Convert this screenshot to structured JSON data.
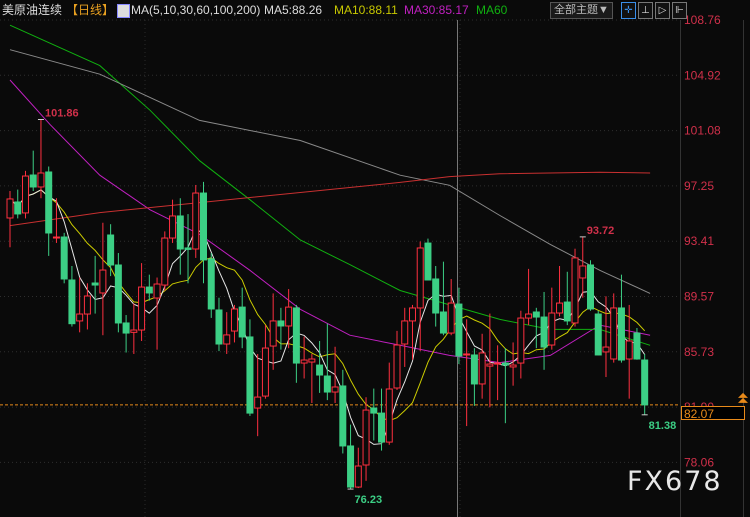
{
  "header": {
    "symbol": "美原油连续",
    "period": "【日线】",
    "ma_params": "MA(5,10,30,60,100,200)",
    "ma5": "MA5:88.26",
    "ma10": "MA10:88.11",
    "ma30": "MA30:85.17",
    "ma60": "MA60",
    "theme_button": "全部主题▼",
    "tool_icons": [
      "crosshair-icon",
      "bar-style-icon",
      "play-icon",
      "exit-icon"
    ]
  },
  "watermark": "FX678",
  "colors": {
    "up": "#ff3040",
    "down": "#3ccf85",
    "ma5": "#e6e6e6",
    "ma10": "#cccc00",
    "ma30": "#c020c0",
    "ma60": "#10b010",
    "ma100": "#8a8a8a",
    "ma200": "#c83030",
    "accent": "#e88a1a",
    "axis_text": "#d0304a"
  },
  "chart_data": {
    "type": "candlestick",
    "title": "美原油连续 日线",
    "y_ticks": [
      "108.76",
      "104.92",
      "101.08",
      "97.25",
      "93.41",
      "89.57",
      "85.73",
      "81.90",
      "78.06"
    ],
    "ylim": [
      76.0,
      108.76
    ],
    "last_price": "82.07",
    "annotations": [
      {
        "text": "101.86",
        "index": 4,
        "price": 101.86,
        "kind": "high"
      },
      {
        "text": "93.72",
        "index": 74,
        "price": 93.72,
        "kind": "high"
      },
      {
        "text": "76.23",
        "index": 44,
        "price": 76.23,
        "kind": "low"
      },
      {
        "text": "81.38",
        "index": 82,
        "price": 81.38,
        "kind": "low"
      }
    ],
    "ohlc": [
      [
        95.03,
        96.9,
        93.0,
        96.35
      ],
      [
        96.14,
        97.0,
        95.0,
        95.31
      ],
      [
        95.38,
        98.3,
        95.0,
        97.94
      ],
      [
        98.01,
        99.7,
        96.9,
        97.18
      ],
      [
        97.18,
        101.86,
        96.4,
        98.15
      ],
      [
        98.22,
        98.6,
        92.4,
        93.99
      ],
      [
        93.64,
        96.4,
        93.3,
        93.71
      ],
      [
        93.71,
        94.0,
        90.5,
        90.8
      ],
      [
        90.73,
        91.7,
        87.5,
        87.7
      ],
      [
        87.89,
        90.9,
        87.1,
        88.37
      ],
      [
        88.37,
        90.5,
        87.3,
        89.62
      ],
      [
        90.52,
        92.4,
        88.4,
        90.38
      ],
      [
        89.83,
        94.7,
        86.9,
        91.42
      ],
      [
        93.85,
        94.6,
        91.0,
        91.77
      ],
      [
        91.77,
        92.6,
        87.1,
        87.75
      ],
      [
        87.75,
        88.3,
        85.7,
        87.05
      ],
      [
        87.1,
        89.1,
        85.6,
        87.26
      ],
      [
        87.26,
        91.9,
        86.5,
        90.24
      ],
      [
        90.24,
        91.1,
        89.3,
        89.83
      ],
      [
        89.48,
        90.9,
        85.9,
        90.45
      ],
      [
        90.38,
        94.1,
        90.0,
        93.64
      ],
      [
        93.64,
        96.3,
        93.3,
        95.17
      ],
      [
        95.17,
        96.4,
        91.1,
        92.88
      ],
      [
        92.95,
        95.3,
        90.5,
        92.85
      ],
      [
        92.88,
        97.32,
        92.26,
        96.76
      ],
      [
        96.76,
        97.53,
        90.5,
        92.12
      ],
      [
        92.19,
        92.6,
        88.1,
        88.72
      ],
      [
        88.65,
        89.5,
        85.8,
        86.29
      ],
      [
        86.29,
        88.5,
        85.6,
        86.92
      ],
      [
        87.19,
        89.0,
        86.4,
        88.72
      ],
      [
        88.85,
        90.2,
        86.0,
        86.78
      ],
      [
        86.78,
        88.0,
        81.3,
        81.5
      ],
      [
        81.85,
        85.6,
        79.9,
        82.61
      ],
      [
        82.68,
        87.6,
        82.5,
        86.01
      ],
      [
        86.15,
        89.8,
        84.5,
        87.89
      ],
      [
        87.89,
        88.8,
        85.9,
        87.54
      ],
      [
        87.54,
        90.1,
        86.0,
        88.85
      ],
      [
        88.79,
        89.0,
        83.6,
        84.97
      ],
      [
        84.97,
        86.8,
        83.9,
        85.18
      ],
      [
        85.04,
        85.6,
        82.2,
        85.25
      ],
      [
        84.83,
        86.5,
        82.9,
        84.14
      ],
      [
        84.07,
        87.7,
        82.4,
        82.96
      ],
      [
        82.96,
        86.1,
        82.2,
        83.31
      ],
      [
        83.38,
        84.5,
        78.7,
        79.22
      ],
      [
        79.22,
        80.7,
        76.23,
        76.37
      ],
      [
        76.37,
        79.1,
        76.3,
        77.83
      ],
      [
        77.9,
        82.6,
        76.8,
        81.71
      ],
      [
        81.85,
        83.2,
        79.6,
        81.5
      ],
      [
        81.5,
        83.2,
        78.9,
        79.49
      ],
      [
        79.49,
        85.0,
        79.3,
        83.17
      ],
      [
        83.24,
        87.2,
        83.1,
        86.22
      ],
      [
        86.29,
        88.8,
        84.7,
        87.89
      ],
      [
        87.89,
        89.0,
        85.2,
        88.79
      ],
      [
        88.79,
        93.4,
        85.8,
        92.95
      ],
      [
        93.29,
        93.6,
        90.7,
        90.73
      ],
      [
        90.8,
        91.7,
        87.5,
        88.44
      ],
      [
        88.51,
        92.0,
        86.9,
        87.05
      ],
      [
        87.05,
        90.8,
        86.9,
        89.13
      ],
      [
        89.06,
        90.2,
        84.9,
        85.46
      ],
      [
        85.53,
        88.0,
        80.6,
        85.6
      ],
      [
        85.53,
        86.0,
        82.0,
        83.52
      ],
      [
        83.52,
        87.0,
        82.5,
        85.67
      ],
      [
        84.76,
        88.4,
        81.9,
        84.9
      ],
      [
        84.9,
        86.2,
        82.4,
        84.97
      ],
      [
        84.97,
        86.0,
        80.8,
        84.83
      ],
      [
        84.7,
        86.4,
        83.4,
        84.83
      ],
      [
        84.97,
        88.6,
        83.9,
        88.09
      ],
      [
        88.09,
        91.5,
        87.6,
        88.37
      ],
      [
        88.51,
        88.8,
        86.0,
        88.16
      ],
      [
        88.16,
        89.9,
        84.5,
        86.08
      ],
      [
        86.22,
        90.2,
        85.9,
        88.44
      ],
      [
        88.44,
        91.7,
        88.2,
        89.13
      ],
      [
        89.2,
        91.3,
        87.6,
        87.89
      ],
      [
        87.75,
        92.9,
        87.5,
        92.26
      ],
      [
        90.87,
        93.72,
        89.5,
        91.7
      ],
      [
        91.77,
        92.1,
        88.6,
        88.72
      ],
      [
        88.37,
        88.6,
        85.5,
        85.53
      ],
      [
        85.74,
        89.6,
        84.0,
        86.08
      ],
      [
        85.25,
        89.8,
        85.0,
        88.79
      ],
      [
        88.79,
        91.1,
        85.0,
        85.18
      ],
      [
        85.25,
        89.0,
        82.5,
        86.5
      ],
      [
        87.05,
        87.4,
        85.2,
        85.25
      ],
      [
        85.18,
        85.6,
        81.38,
        82.07
      ]
    ],
    "ma_lines": [
      {
        "name": "MA30",
        "points": [
          [
            0,
            104.6
          ],
          [
            5.2,
            101.5
          ],
          [
            11.6,
            98.0
          ],
          [
            18.1,
            95.6
          ],
          [
            24.5,
            93.9
          ],
          [
            31,
            91.4
          ],
          [
            37.5,
            88.7
          ],
          [
            43.9,
            86.9
          ],
          [
            50.4,
            86.2
          ],
          [
            56.8,
            85.5
          ],
          [
            63.3,
            85.0
          ],
          [
            69.8,
            85.5
          ],
          [
            76.2,
            87.6
          ],
          [
            82.7,
            86.9
          ]
        ]
      },
      {
        "name": "MA60",
        "points": [
          [
            0,
            108.4
          ],
          [
            11.6,
            105.6
          ],
          [
            18.1,
            102.5
          ],
          [
            24.5,
            99.0
          ],
          [
            31,
            96.3
          ],
          [
            37.5,
            93.5
          ],
          [
            43.9,
            91.8
          ],
          [
            50.4,
            90.0
          ],
          [
            56.8,
            89.0
          ],
          [
            63.3,
            88.0
          ],
          [
            69.8,
            87.3
          ],
          [
            76.2,
            87.3
          ],
          [
            82.7,
            86.2
          ]
        ]
      },
      {
        "name": "MA100",
        "points": [
          [
            0,
            106.7
          ],
          [
            11.6,
            105.0
          ],
          [
            24.5,
            101.8
          ],
          [
            37.5,
            100.4
          ],
          [
            50.4,
            98.0
          ],
          [
            56.8,
            97.3
          ],
          [
            63.3,
            95.2
          ],
          [
            69.8,
            93.2
          ],
          [
            76.2,
            91.4
          ],
          [
            82.7,
            89.8
          ]
        ]
      },
      {
        "name": "MA200",
        "points": [
          [
            0,
            94.5
          ],
          [
            11.6,
            95.4
          ],
          [
            24.5,
            96.1
          ],
          [
            37.5,
            96.8
          ],
          [
            50.4,
            97.5
          ],
          [
            56.8,
            97.9
          ],
          [
            63.3,
            98.1
          ],
          [
            76.2,
            98.2
          ],
          [
            82.7,
            98.15
          ]
        ]
      }
    ]
  }
}
